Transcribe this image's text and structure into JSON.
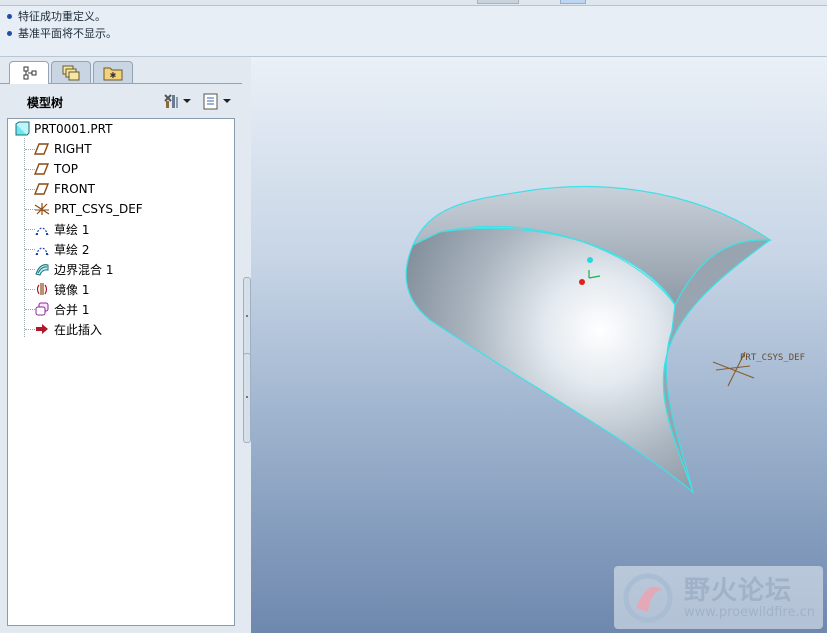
{
  "messages": [
    "特征成功重定义。",
    "基准平面将不显示。"
  ],
  "left_panel": {
    "tabs": [
      {
        "name": "model-tree-tab-icon",
        "active": true
      },
      {
        "name": "layers-tab-icon",
        "active": false
      },
      {
        "name": "favorites-folder-tab-icon",
        "active": false
      }
    ],
    "title": "模型树",
    "settings_icon": "tree-settings-icon",
    "show_icon": "tree-show-icon"
  },
  "tree": {
    "root": "PRT0001.PRT",
    "items": [
      {
        "label": "RIGHT",
        "icon": "datum-plane-icon"
      },
      {
        "label": "TOP",
        "icon": "datum-plane-icon"
      },
      {
        "label": "FRONT",
        "icon": "datum-plane-icon"
      },
      {
        "label": "PRT_CSYS_DEF",
        "icon": "csys-icon"
      },
      {
        "label": "草绘 1",
        "icon": "sketch-icon"
      },
      {
        "label": "草绘 2",
        "icon": "sketch-icon"
      },
      {
        "label": "边界混合 1",
        "icon": "boundary-blend-icon"
      },
      {
        "label": "镜像 1",
        "icon": "mirror-icon"
      },
      {
        "label": "合并 1",
        "icon": "merge-icon"
      },
      {
        "label": "在此插入",
        "icon": "insert-here-arrow-icon"
      }
    ]
  },
  "viewport": {
    "csys_label": "PRT_CSYS_DEF",
    "edge_color": "#3fe0e6",
    "csys_color": "#8a5a2b"
  },
  "watermark": {
    "title": "野火论坛",
    "url": "www.proewildfire.cn"
  }
}
